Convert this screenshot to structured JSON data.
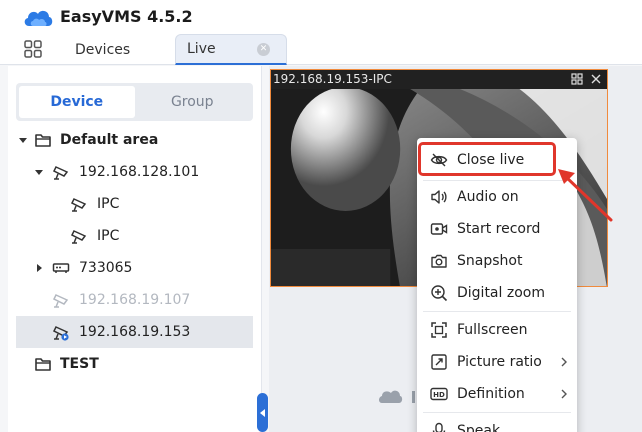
{
  "app": {
    "title": "EasyVMS 4.5.2"
  },
  "tabs": [
    {
      "label": "Devices"
    },
    {
      "label": "Live"
    }
  ],
  "segment": {
    "device": "Device",
    "group": "Group"
  },
  "tree": [
    {
      "label": "Default area"
    },
    {
      "label": "192.168.128.101"
    },
    {
      "label": "IPC"
    },
    {
      "label": "IPC"
    },
    {
      "label": "733065"
    },
    {
      "label": "192.168.19.107"
    },
    {
      "label": "192.168.19.153"
    },
    {
      "label": "TEST"
    }
  ],
  "tile": {
    "title": "192.168.19.153-IPC"
  },
  "menu": {
    "close_live": "Close live",
    "audio_on": "Audio on",
    "start_record": "Start record",
    "snapshot": "Snapshot",
    "digital_zoom": "Digital zoom",
    "fullscreen": "Fullscreen",
    "picture_ratio": "Picture ratio",
    "definition": "Definition",
    "speak": "Speak"
  },
  "colors": {
    "accent": "#2c6fd6",
    "annotation": "#e0362b",
    "tile_border": "#f08a3c"
  }
}
